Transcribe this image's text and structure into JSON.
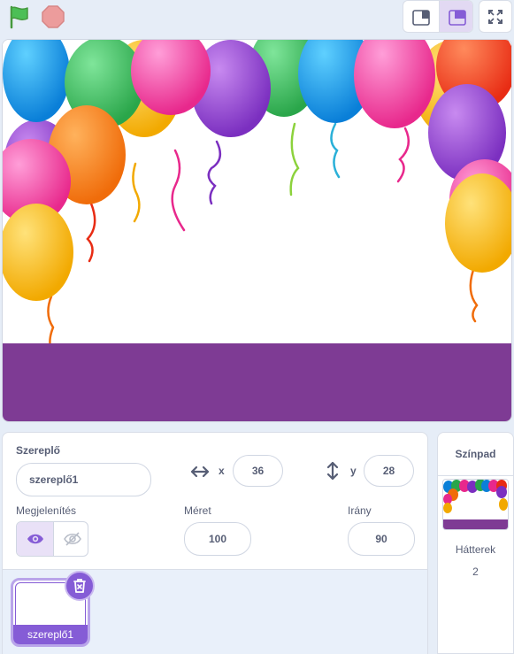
{
  "controls": {
    "green_flag_icon": "green-flag-icon",
    "stop_icon": "stop-sign-icon"
  },
  "sprite_info": {
    "title": "Szereplő",
    "name_value": "szereplő1",
    "x_label": "x",
    "x_value": "36",
    "y_label": "y",
    "y_value": "28",
    "show_label": "Megjelenítés",
    "size_label": "Méret",
    "size_value": "100",
    "direction_label": "Irány",
    "direction_value": "90"
  },
  "sprites": [
    {
      "name": "szereplő1",
      "selected": true
    }
  ],
  "stage_selector": {
    "title": "Színpad",
    "backdrops_label": "Hátterek",
    "backdrops_count": "2"
  },
  "colors": {
    "accent": "#855cd6",
    "stage_floor": "#7e3b94",
    "flag": "#4cbf56",
    "stop": "#ec9c9c"
  }
}
